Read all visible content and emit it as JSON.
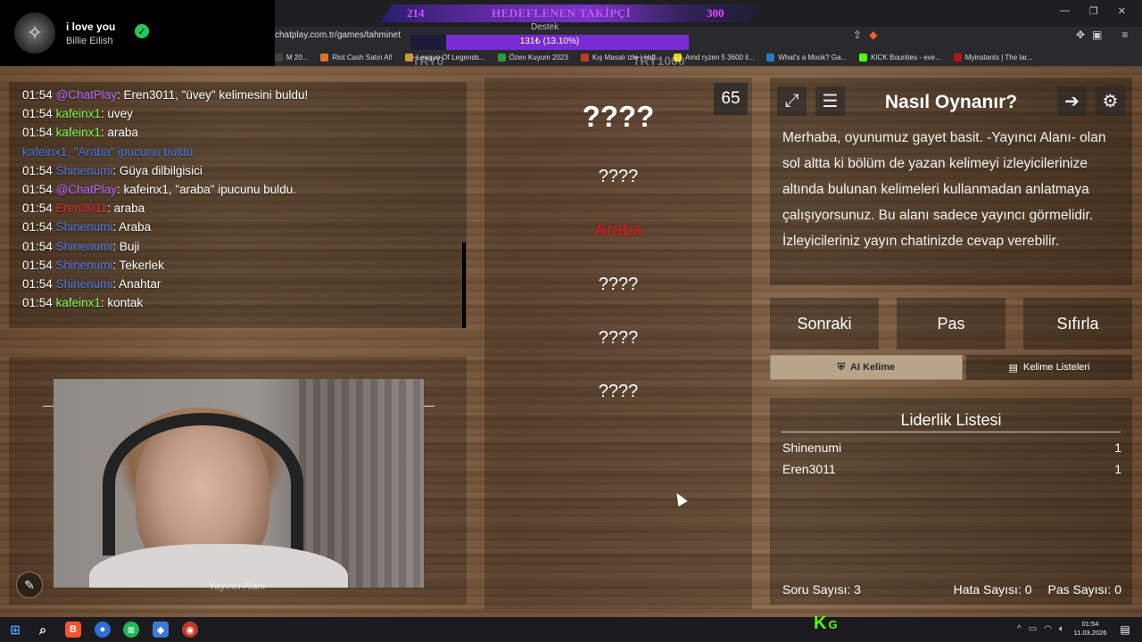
{
  "browser": {
    "url": "chatplay.com.tr/games/tahminet",
    "bookmarks": [
      {
        "label": "M 20...",
        "color": "#444"
      },
      {
        "label": "Riot Cash Satın Al!",
        "color": "#d8752a"
      },
      {
        "label": "League Of Legends...",
        "color": "#c89b3c"
      },
      {
        "label": "Özen Kuyum 2023",
        "color": "#2c9c3a"
      },
      {
        "label": "Kış Masalı izle | Hdf...",
        "color": "#c0392b"
      },
      {
        "label": "Amd ryzen 5 3600 il...",
        "color": "#e8d21b"
      },
      {
        "label": "What's a Mook? Ga...",
        "color": "#2a78c8"
      },
      {
        "label": "KICK Bounties - eve...",
        "color": "#53fc18"
      },
      {
        "label": "Myinstants | The lar...",
        "color": "#b5121b"
      }
    ],
    "overlay_left": "TRY0",
    "overlay_right": "TRY1000"
  },
  "now_playing": {
    "title": "i love you",
    "artist": "Billie Eilish"
  },
  "goal": {
    "current": "214",
    "label": "HEDEFLENEN TAKİPÇİ",
    "target": "300"
  },
  "support": {
    "label": "Destek",
    "text": "131₺ (13.10%)",
    "progress": 0.131
  },
  "chat": [
    {
      "time": "01:54",
      "user": "@ChatPlay",
      "user_color": "purple",
      "message": ": Eren3011, \"üvey\" kelimesini buldu!"
    },
    {
      "time": "01:54",
      "user": "kafeinx1",
      "user_color": "green",
      "message": ": uvey"
    },
    {
      "time": "01:54",
      "user": "kafeinx1",
      "user_color": "green",
      "message": ": araba"
    },
    {
      "time": "",
      "user": "kafeinx1",
      "user_color": "hint",
      "message": ", \"Araba\" ipucunu buldu."
    },
    {
      "time": "01:54",
      "user": "Shinenumi",
      "user_color": "blue",
      "message": ": Güya dilbilgisici"
    },
    {
      "time": "01:54",
      "user": "@ChatPlay",
      "user_color": "purple",
      "message": ": kafeinx1, \"araba\" ipucunu buldu."
    },
    {
      "time": "01:54",
      "user": "Eren3011",
      "user_color": "red",
      "message": ": araba"
    },
    {
      "time": "01:54",
      "user": "Shinenumi",
      "user_color": "blue",
      "message": ": Araba"
    },
    {
      "time": "01:54",
      "user": "Shinenumi",
      "user_color": "blue",
      "message": ": Buji"
    },
    {
      "time": "01:54",
      "user": "Shinenumi",
      "user_color": "blue",
      "message": ": Tekerlek"
    },
    {
      "time": "01:54",
      "user": "Shinenumi",
      "user_color": "blue",
      "message": ": Anahtar"
    },
    {
      "time": "01:54",
      "user": "kafeinx1",
      "user_color": "green",
      "message": ": kontak"
    }
  ],
  "camera": {
    "caption": "Yayıncı Alanı"
  },
  "game": {
    "timer": "65",
    "main_word": "????",
    "words": [
      "????",
      "Araba",
      "????",
      "????",
      "????"
    ]
  },
  "how_to": {
    "title": "Nasıl Oynanır?",
    "text": "Merhaba, oyunumuz gayet basit. -Yayıncı Alanı- olan sol altta ki bölüm de yazan kelimeyi izleyicilerinize altında bulunan kelimeleri kullanmadan anlatmaya çalışıyorsunuz. Bu alanı sadece yayıncı görmelidir. İzleyicileriniz yayın chatinizde cevap verebilir."
  },
  "controls": {
    "next": "Sonraki",
    "pass": "Pas",
    "reset": "Sıfırla",
    "ai_word": "AI Kelime",
    "word_lists": "Kelime Listeleri"
  },
  "leaderboard": {
    "title": "Liderlik Listesi",
    "rows": [
      {
        "name": "Shinenumi",
        "score": "1"
      },
      {
        "name": "Eren3011",
        "score": "1"
      }
    ]
  },
  "stats": {
    "questions": "Soru Sayısı: 3",
    "errors": "Hata Sayısı: 0",
    "passes": "Pas Sayısı: 0"
  },
  "taskbar": {
    "time": "01:54",
    "date": "11.03.2026"
  },
  "colors": {
    "green": "#7cff4f",
    "purple": "#b069ff",
    "blue": "#4c79e8",
    "red": "#e02f2f",
    "hint": "#3e77e6",
    "taboo_red": "#e3141b",
    "kick_green": "#53fc18"
  }
}
